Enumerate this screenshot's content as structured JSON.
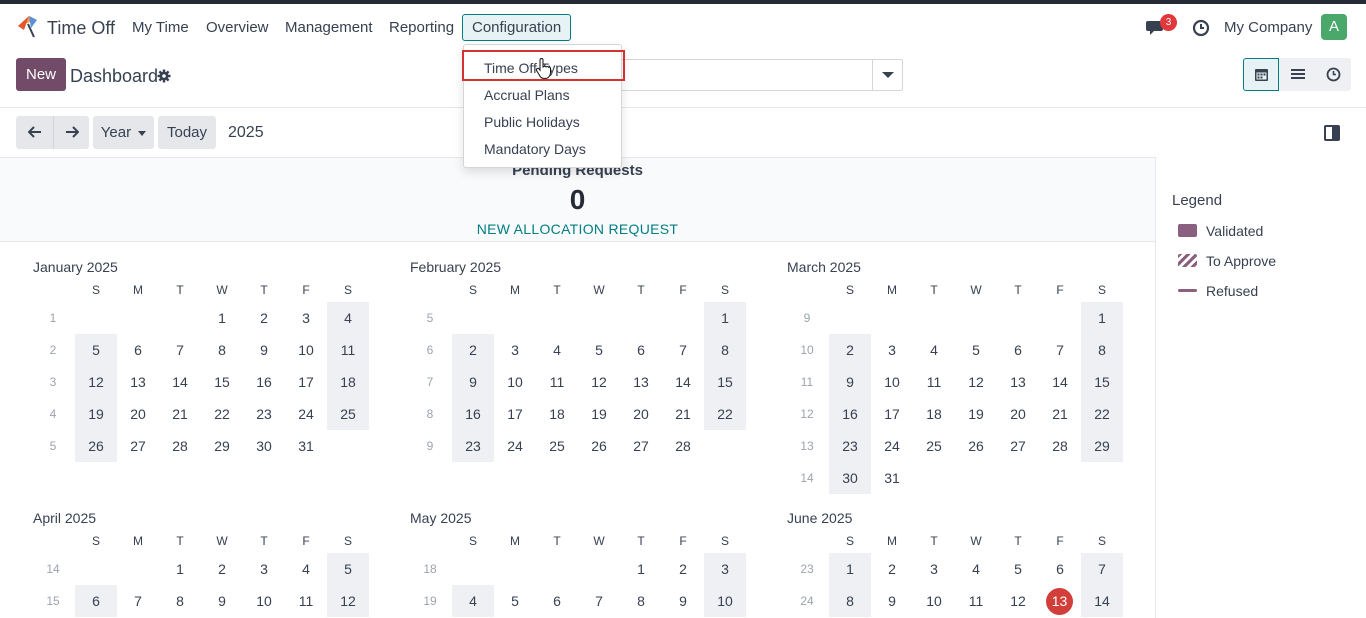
{
  "app": {
    "name": "Time Off"
  },
  "nav": {
    "items": [
      "My Time",
      "Overview",
      "Management",
      "Reporting",
      "Configuration"
    ]
  },
  "systray": {
    "messages_count": "3",
    "company": "My Company",
    "avatar_letter": "A"
  },
  "control_panel": {
    "new_label": "New",
    "title": "Dashboard"
  },
  "calendar_controls": {
    "scale": "Year",
    "today": "Today",
    "period": "2025"
  },
  "dropdown": {
    "items": [
      "Time Off Types",
      "Accrual Plans",
      "Public Holidays",
      "Mandatory Days"
    ]
  },
  "pending": {
    "title": "Pending Requests",
    "count": "0",
    "link": "NEW ALLOCATION REQUEST"
  },
  "legend": {
    "title": "Legend",
    "items": [
      {
        "label": "Validated",
        "style": "solid",
        "color": "#8a5f80"
      },
      {
        "label": "To Approve",
        "style": "striped",
        "color": "#8a5f80"
      },
      {
        "label": "Refused",
        "style": "line",
        "color": "#8a5f80"
      }
    ]
  },
  "calendar": {
    "weekdays": [
      "S",
      "M",
      "T",
      "W",
      "T",
      "F",
      "S"
    ],
    "today_date": "2025-06-13",
    "months": [
      {
        "name": "January 2025",
        "weeks": [
          {
            "num": "1",
            "days": [
              "",
              "",
              "",
              "1",
              "2",
              "3",
              "4"
            ]
          },
          {
            "num": "2",
            "days": [
              "5",
              "6",
              "7",
              "8",
              "9",
              "10",
              "11"
            ]
          },
          {
            "num": "3",
            "days": [
              "12",
              "13",
              "14",
              "15",
              "16",
              "17",
              "18"
            ]
          },
          {
            "num": "4",
            "days": [
              "19",
              "20",
              "21",
              "22",
              "23",
              "24",
              "25"
            ]
          },
          {
            "num": "5",
            "days": [
              "26",
              "27",
              "28",
              "29",
              "30",
              "31",
              ""
            ]
          }
        ]
      },
      {
        "name": "February 2025",
        "weeks": [
          {
            "num": "5",
            "days": [
              "",
              "",
              "",
              "",
              "",
              "",
              "1"
            ]
          },
          {
            "num": "6",
            "days": [
              "2",
              "3",
              "4",
              "5",
              "6",
              "7",
              "8"
            ]
          },
          {
            "num": "7",
            "days": [
              "9",
              "10",
              "11",
              "12",
              "13",
              "14",
              "15"
            ]
          },
          {
            "num": "8",
            "days": [
              "16",
              "17",
              "18",
              "19",
              "20",
              "21",
              "22"
            ]
          },
          {
            "num": "9",
            "days": [
              "23",
              "24",
              "25",
              "26",
              "27",
              "28",
              ""
            ]
          }
        ]
      },
      {
        "name": "March 2025",
        "weeks": [
          {
            "num": "9",
            "days": [
              "",
              "",
              "",
              "",
              "",
              "",
              "1"
            ]
          },
          {
            "num": "10",
            "days": [
              "2",
              "3",
              "4",
              "5",
              "6",
              "7",
              "8"
            ]
          },
          {
            "num": "11",
            "days": [
              "9",
              "10",
              "11",
              "12",
              "13",
              "14",
              "15"
            ]
          },
          {
            "num": "12",
            "days": [
              "16",
              "17",
              "18",
              "19",
              "20",
              "21",
              "22"
            ]
          },
          {
            "num": "13",
            "days": [
              "23",
              "24",
              "25",
              "26",
              "27",
              "28",
              "29"
            ]
          },
          {
            "num": "14",
            "days": [
              "30",
              "31",
              "",
              "",
              "",
              "",
              ""
            ]
          }
        ]
      },
      {
        "name": "April 2025",
        "weeks": [
          {
            "num": "14",
            "days": [
              "",
              "",
              "1",
              "2",
              "3",
              "4",
              "5"
            ]
          },
          {
            "num": "15",
            "days": [
              "6",
              "7",
              "8",
              "9",
              "10",
              "11",
              "12"
            ]
          }
        ]
      },
      {
        "name": "May 2025",
        "weeks": [
          {
            "num": "18",
            "days": [
              "",
              "",
              "",
              "",
              "1",
              "2",
              "3"
            ]
          },
          {
            "num": "19",
            "days": [
              "4",
              "5",
              "6",
              "7",
              "8",
              "9",
              "10"
            ]
          }
        ]
      },
      {
        "name": "June 2025",
        "weeks": [
          {
            "num": "23",
            "days": [
              "1",
              "2",
              "3",
              "4",
              "5",
              "6",
              "7"
            ]
          },
          {
            "num": "24",
            "days": [
              "8",
              "9",
              "10",
              "11",
              "12",
              "13",
              "14"
            ]
          }
        ]
      }
    ]
  }
}
